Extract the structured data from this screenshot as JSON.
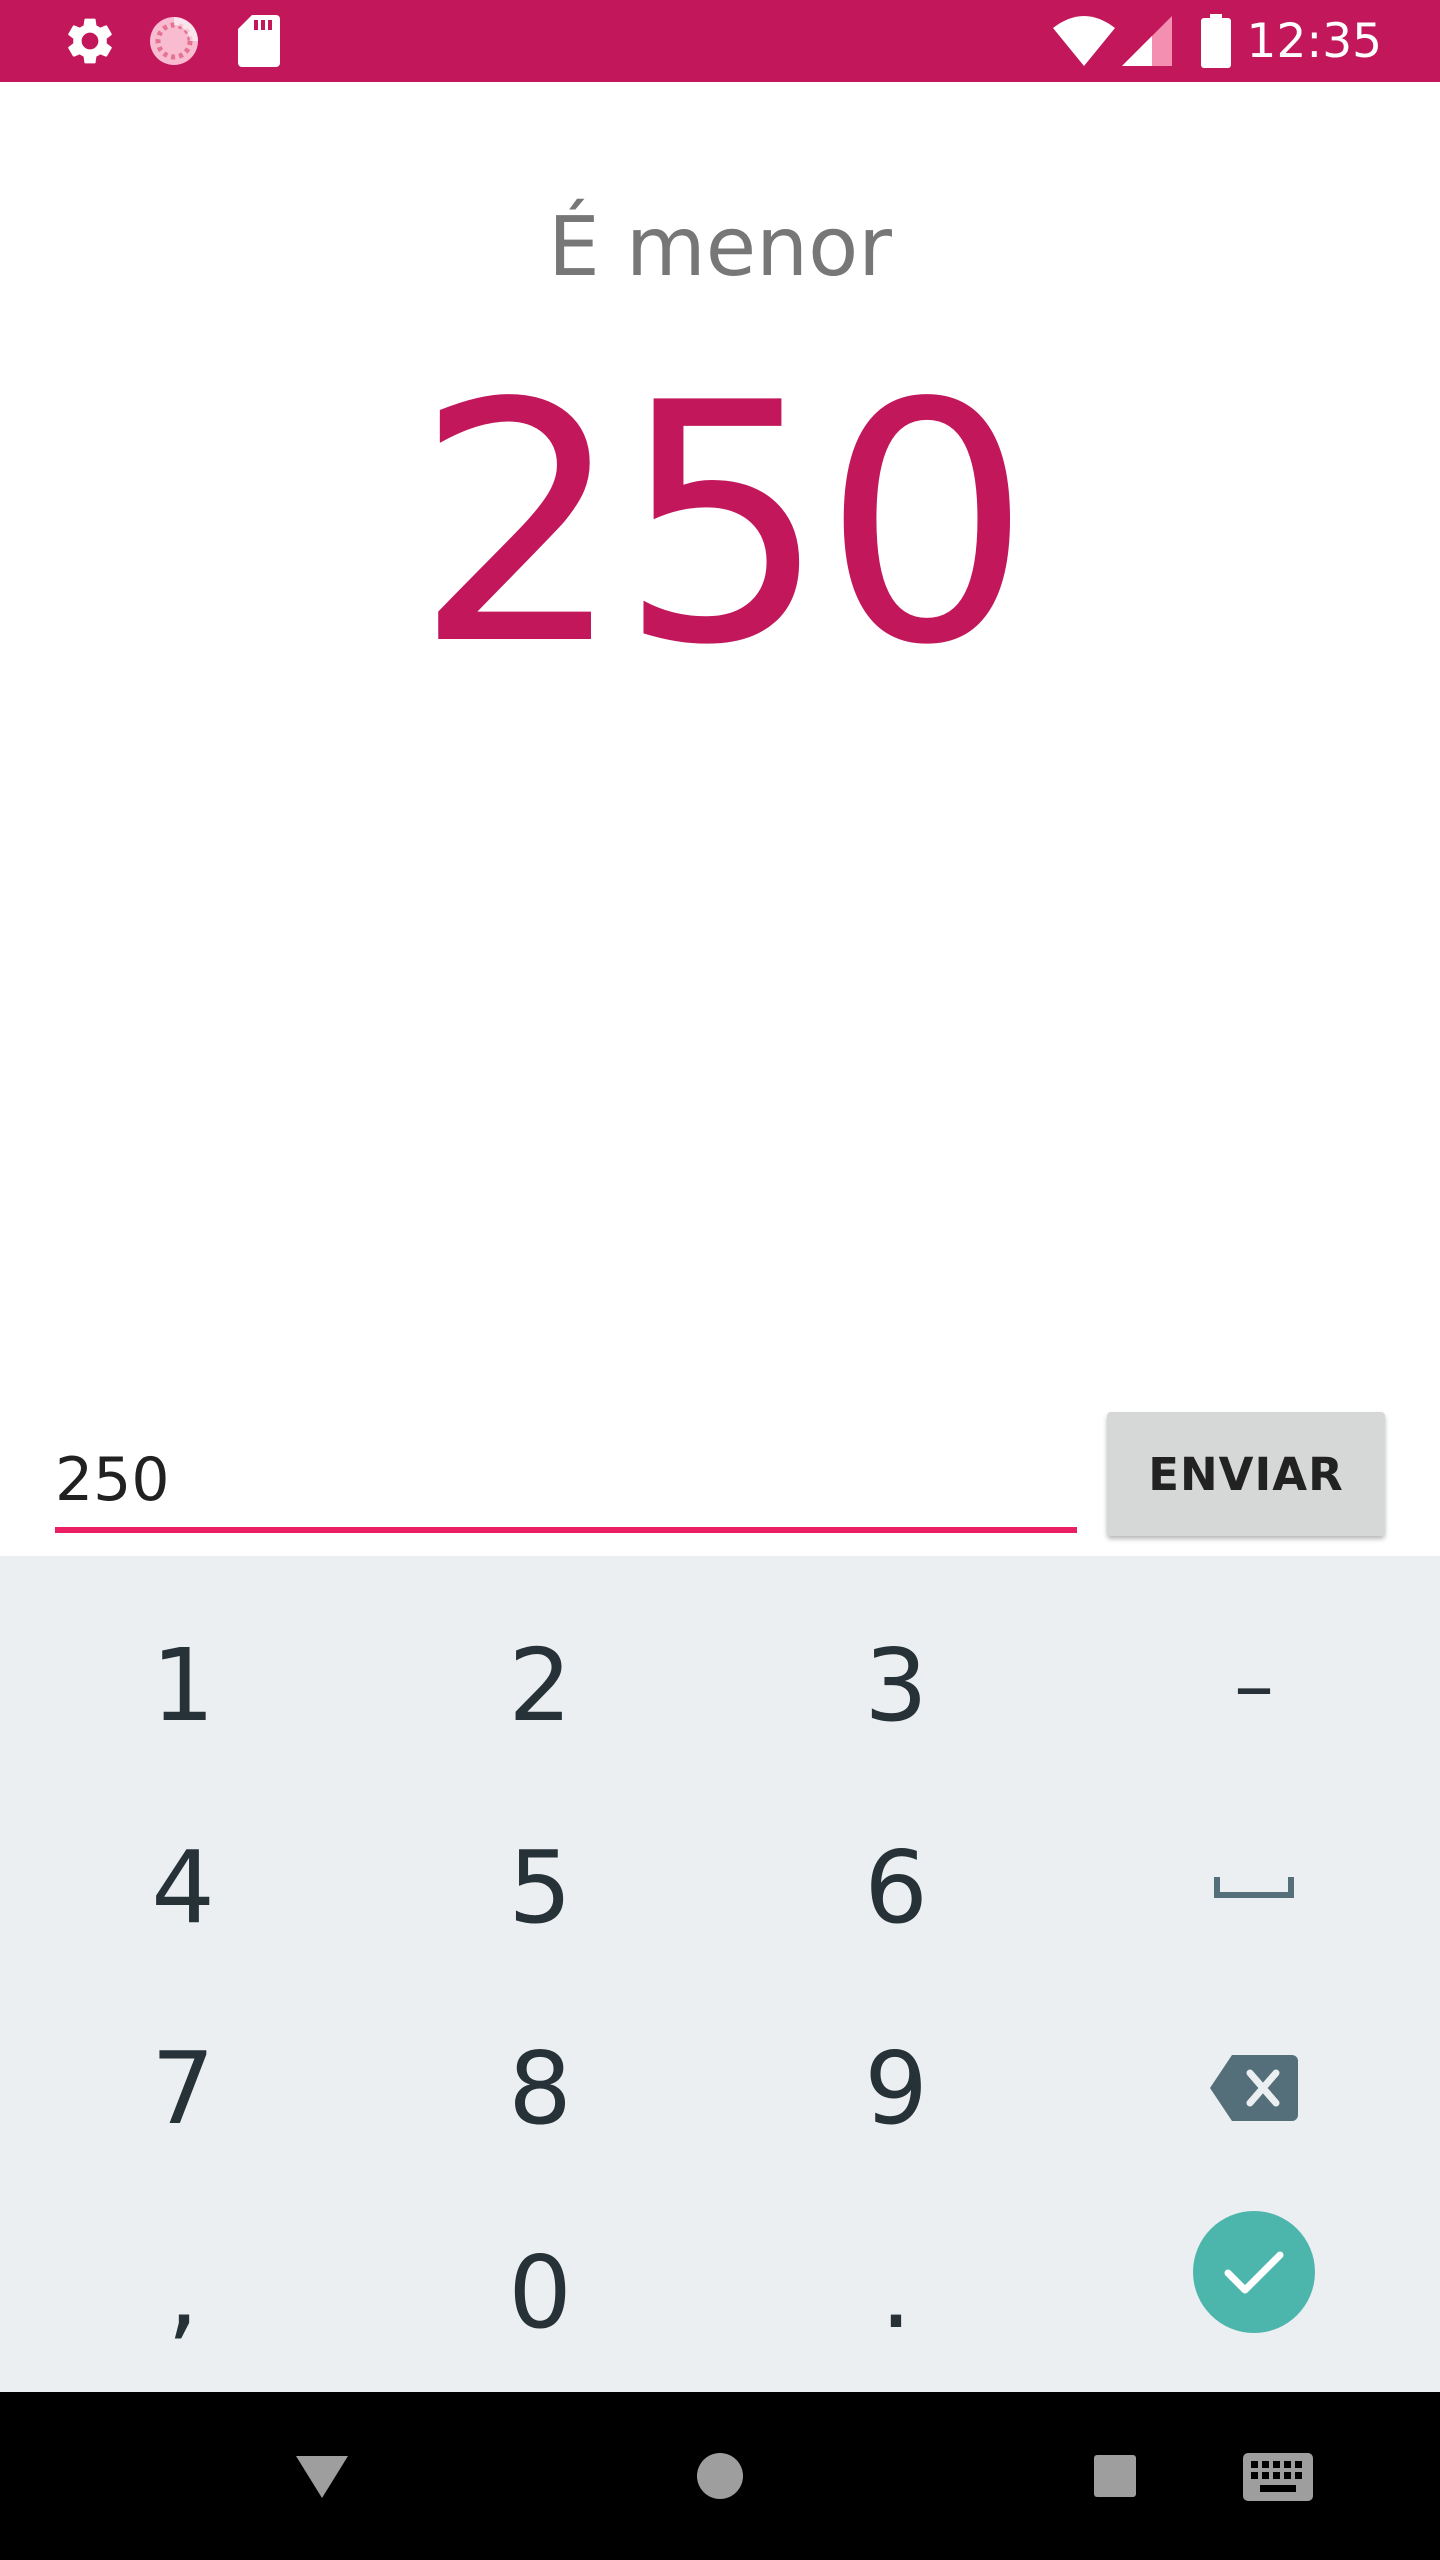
{
  "status_bar": {
    "time": "12:35",
    "bg_color": "#c2185b",
    "icons_left": [
      "settings-icon",
      "loading-icon",
      "sd-card-icon"
    ],
    "icons_right": [
      "wifi-icon",
      "signal-icon",
      "battery-icon"
    ]
  },
  "main": {
    "hint": "É menor",
    "number": "250",
    "accent_color": "#c2185b"
  },
  "form": {
    "input_value": "250",
    "send_label": "ENVIAR"
  },
  "keyboard": {
    "rows": [
      [
        "1",
        "2",
        "3",
        "–"
      ],
      [
        "4",
        "5",
        "6",
        "space"
      ],
      [
        "7",
        "8",
        "9",
        "backspace"
      ],
      [
        ",",
        "0",
        ".",
        "done"
      ]
    ],
    "done_color": "#4db6ac"
  },
  "nav_bar": {
    "icons": [
      "back-icon",
      "home-icon",
      "recents-icon",
      "keyboard-switch-icon"
    ]
  }
}
